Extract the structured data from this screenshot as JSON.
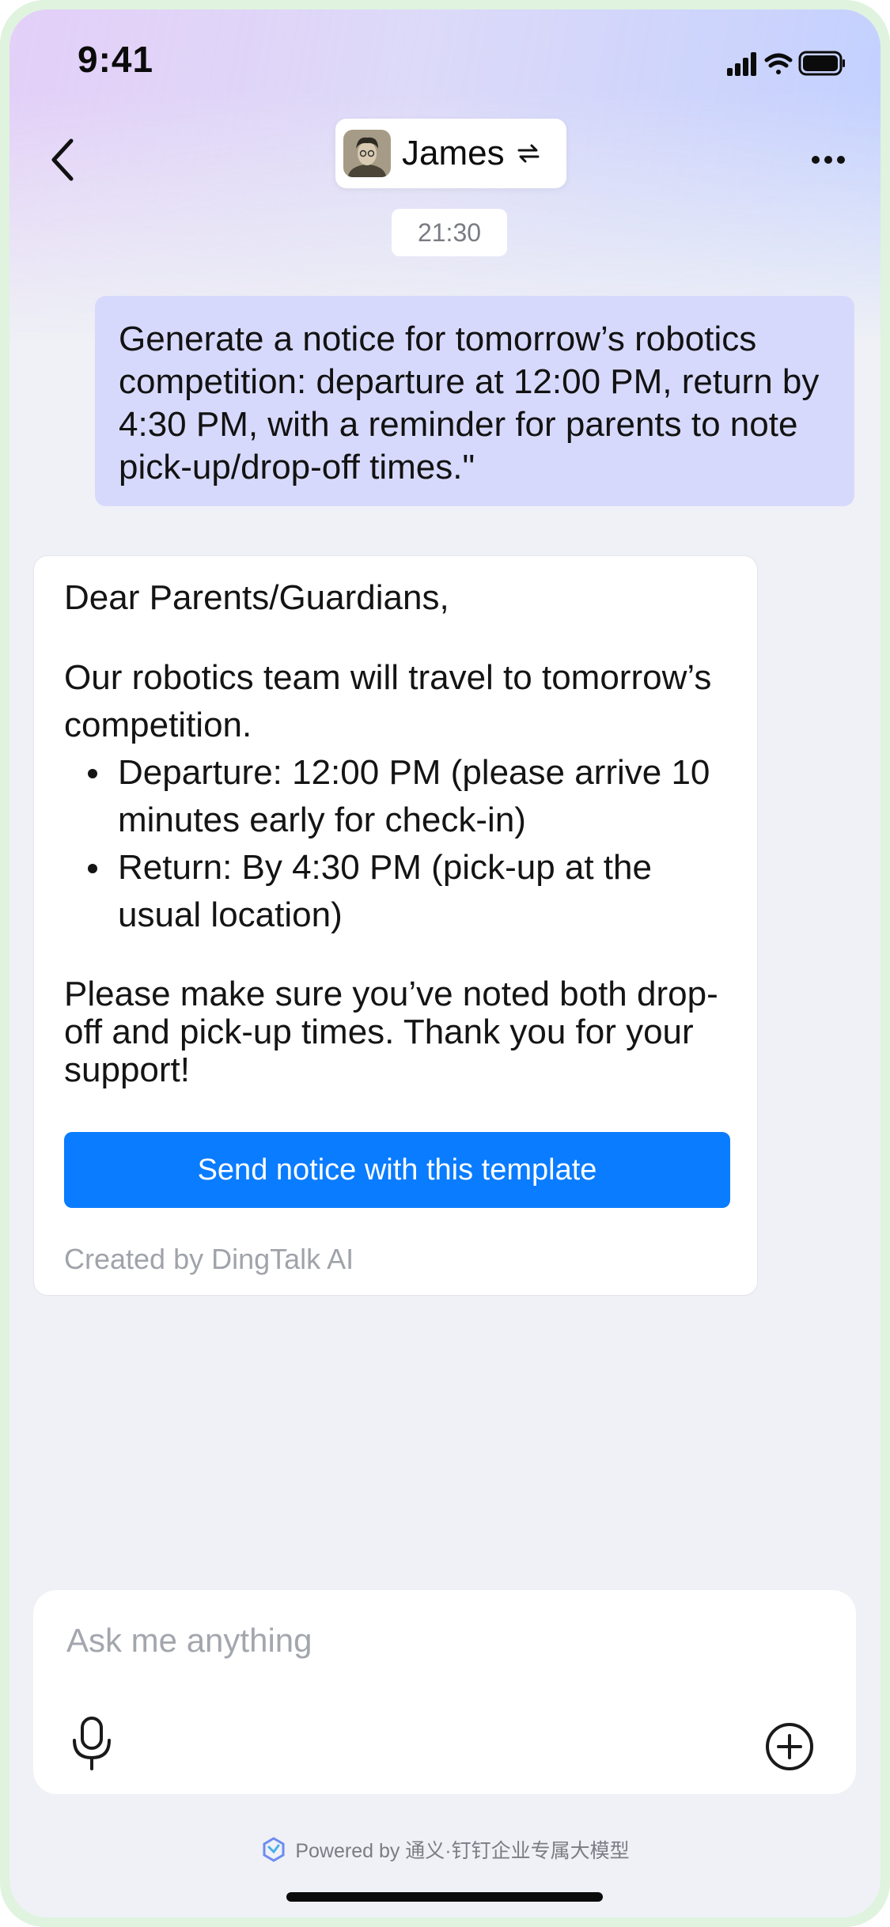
{
  "status_bar": {
    "time": "9:41",
    "icons": [
      "cellular-signal-icon",
      "wifi-icon",
      "battery-icon"
    ]
  },
  "header": {
    "back_icon": "chevron-left-icon",
    "contact_name": "James",
    "switch_icon": "swap-arrows-icon",
    "more_icon": "ellipsis-icon"
  },
  "chat": {
    "timestamp": "21:30",
    "user_message": "Generate a notice for tomorrow’s robotics competition: departure at 12:00 PM, return by 4:30 PM, with a reminder for parents to note pick-up/drop-off times.\"",
    "ai_card": {
      "greeting": "Dear Parents/Guardians,",
      "intro": "Our robotics team will travel to tomorrow’s competition.",
      "bullets": [
        "Departure: 12:00 PM (please arrive 10 minutes early for check-in)",
        "Return: By 4:30 PM (pick-up at the usual location)"
      ],
      "closing": "Please make sure you’ve noted both drop-off and pick-up times. Thank you for your support!",
      "button_label": "Send notice with this template",
      "footer": "Created by DingTalk AI"
    }
  },
  "input": {
    "placeholder": "Ask me anything",
    "value": "",
    "mic_icon": "microphone-icon",
    "plus_icon": "plus-circle-icon"
  },
  "footer": {
    "powered_by": "Powered by 通义·钉钉企业专属大模型"
  },
  "colors": {
    "accent": "#0a7cff",
    "user_bubble": "#d7d9fc",
    "background": "#eff1f6",
    "frame": "#dff3df"
  }
}
